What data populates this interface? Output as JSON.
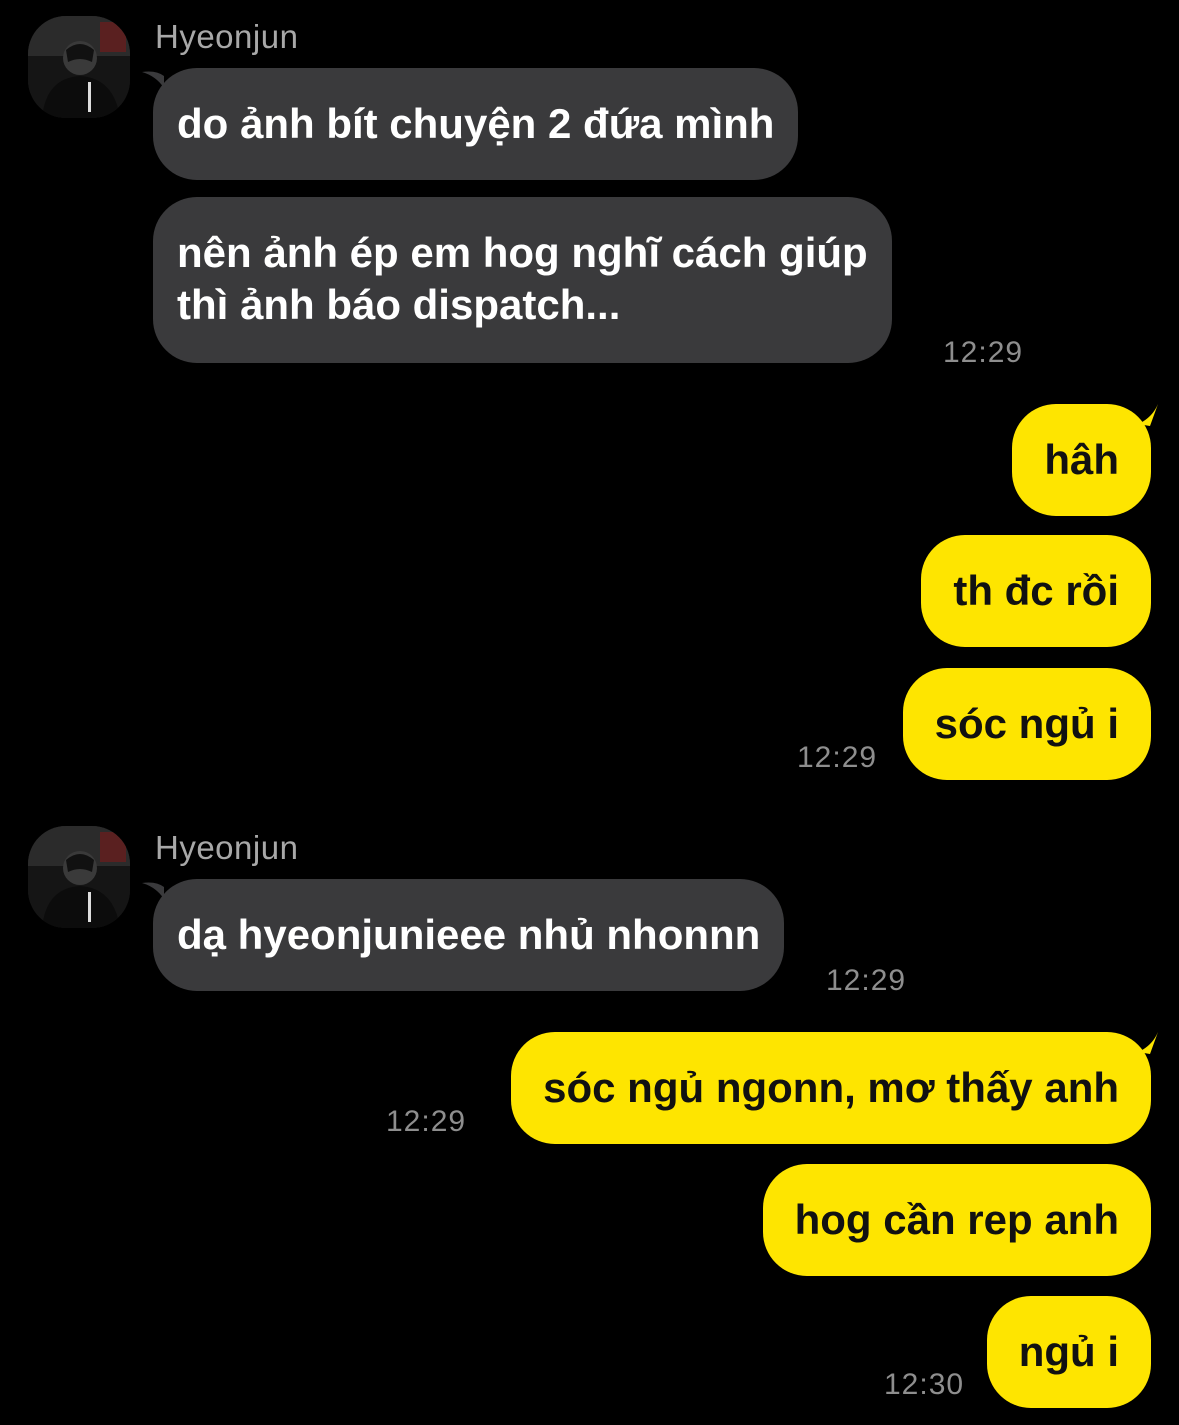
{
  "colors": {
    "background": "#000000",
    "incoming_bubble": "#3a3a3c",
    "outgoing_bubble": "#fee500",
    "sender_name": "#a8a8a8",
    "timestamp": "#8e8e8e"
  },
  "groups": [
    {
      "side": "incoming",
      "sender": "Hyeonjun",
      "avatar_icon": "profile-photo",
      "messages": [
        "do ảnh bít chuyện 2 đứa mình",
        "nên ảnh ép em hog nghĩ cách giúp\nthì ảnh báo dispatch..."
      ],
      "time": "12:29"
    },
    {
      "side": "outgoing",
      "messages": [
        "hâh",
        "th đc rồi",
        "sóc ngủ i"
      ],
      "time": "12:29"
    },
    {
      "side": "incoming",
      "sender": "Hyeonjun",
      "avatar_icon": "profile-photo",
      "messages": [
        "dạ hyeonjunieee nhủ nhonnn"
      ],
      "time": "12:29"
    },
    {
      "side": "outgoing",
      "messages": [
        "sóc ngủ ngonn, mơ thấy anh",
        "hog cần rep anh",
        "ngủ i"
      ],
      "time_first": "12:29",
      "time": "12:30"
    }
  ]
}
